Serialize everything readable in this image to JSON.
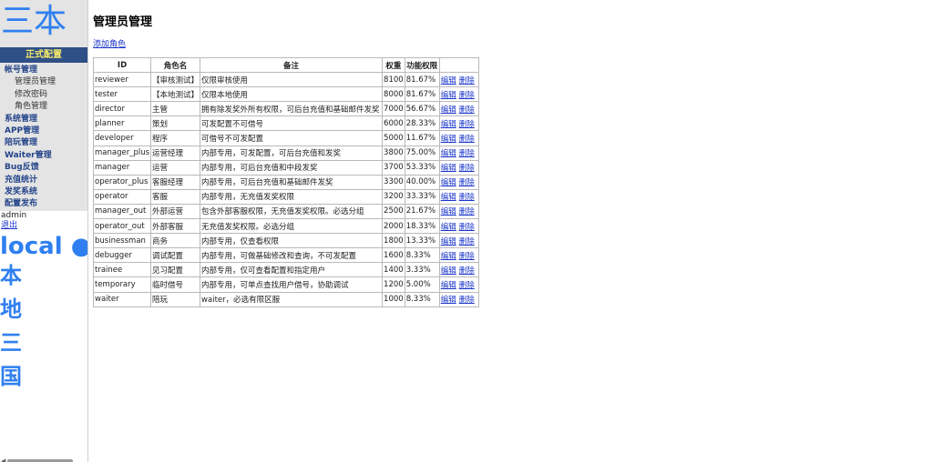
{
  "sidebar": {
    "logo": "三本",
    "config_label": "正式配置",
    "nav": [
      {
        "label": "帐号管理",
        "sub": false
      },
      {
        "label": "管理员管理",
        "sub": true
      },
      {
        "label": "修改密码",
        "sub": true
      },
      {
        "label": "角色管理",
        "sub": true
      },
      {
        "label": "系统管理",
        "sub": false
      },
      {
        "label": "APP管理",
        "sub": false
      },
      {
        "label": "陪玩管理",
        "sub": false
      },
      {
        "label": "Waiter管理",
        "sub": false
      },
      {
        "label": "Bug反馈",
        "sub": false
      },
      {
        "label": "充值统计",
        "sub": false
      },
      {
        "label": "发奖系统",
        "sub": false
      },
      {
        "label": "配置发布",
        "sub": false
      }
    ],
    "user": "admin",
    "logout": "退出",
    "env": "local ●",
    "env_chars": [
      "本",
      "地",
      "三",
      "国"
    ]
  },
  "main": {
    "title": "管理员管理",
    "add_role": "添加角色",
    "columns": [
      "ID",
      "角色名",
      "备注",
      "权重",
      "功能权限",
      ""
    ],
    "action_edit": "编辑",
    "action_delete": "删除",
    "rows": [
      [
        "reviewer",
        "【审核测试】",
        "仅限审核使用",
        "8100",
        "81.67%"
      ],
      [
        "tester",
        "【本地测试】",
        "仅限本地使用",
        "8000",
        "81.67%"
      ],
      [
        "director",
        "主管",
        "拥有除发奖外所有权限，可后台充值和基础邮件发奖",
        "7000",
        "56.67%"
      ],
      [
        "planner",
        "策划",
        "可发配置不可借号",
        "6000",
        "28.33%"
      ],
      [
        "developer",
        "程序",
        "可借号不可发配置",
        "5000",
        "11.67%"
      ],
      [
        "manager_plus",
        "运营经理",
        "内部专用，可发配置，可后台充值和发奖",
        "3800",
        "75.00%"
      ],
      [
        "manager",
        "运营",
        "内部专用，可后台充值和中段发奖",
        "3700",
        "53.33%"
      ],
      [
        "operator_plus",
        "客服经理",
        "内部专用，可后台充值和基础邮件发奖",
        "3300",
        "40.00%"
      ],
      [
        "operator",
        "客服",
        "内部专用，无充值发奖权限",
        "3200",
        "33.33%"
      ],
      [
        "manager_out",
        "外部运营",
        "包含外部客服权限，无充值发奖权限。必选分组",
        "2500",
        "21.67%"
      ],
      [
        "operator_out",
        "外部客服",
        "无充值发奖权限。必选分组",
        "2000",
        "18.33%"
      ],
      [
        "businessman",
        "商务",
        "内部专用，仅查看权限",
        "1800",
        "13.33%"
      ],
      [
        "debugger",
        "调试配置",
        "内部专用，可做基础修改和查询，不可发配置",
        "1600",
        "8.33%"
      ],
      [
        "trainee",
        "见习配置",
        "内部专用，仅可查看配置和指定用户",
        "1400",
        "3.33%"
      ],
      [
        "temporary",
        "临时借号",
        "内部专用，可单点查找用户借号，协助调试",
        "1200",
        "5.00%"
      ],
      [
        "waiter",
        "陪玩",
        "waiter，必选有限区服",
        "1000",
        "8.33%"
      ]
    ]
  }
}
